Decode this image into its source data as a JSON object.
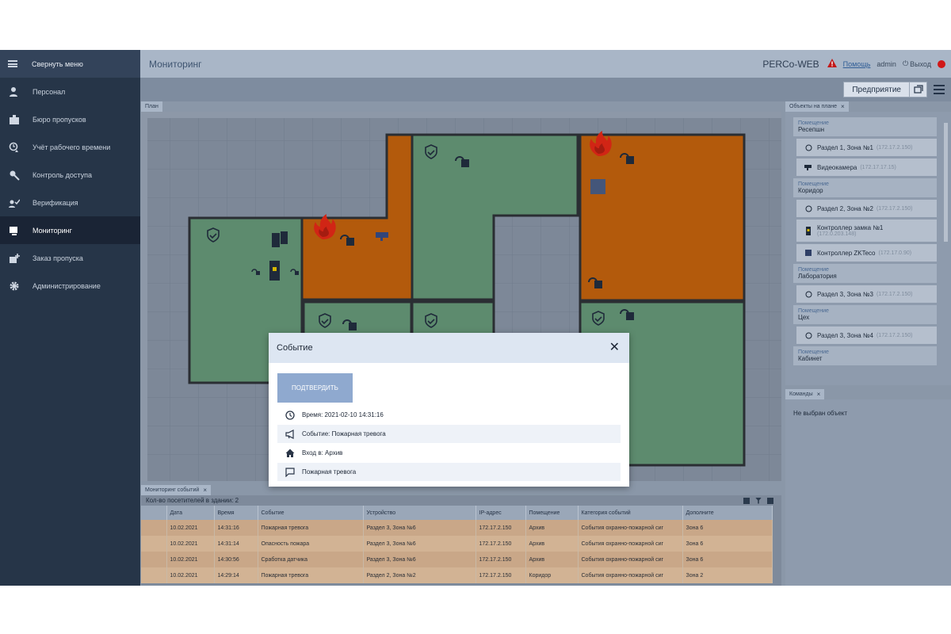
{
  "sidebar": {
    "collapse_label": "Свернуть меню",
    "items": [
      {
        "label": "Персонал",
        "icon": "person-icon"
      },
      {
        "label": "Бюро пропусков",
        "icon": "badge-icon"
      },
      {
        "label": "Учёт рабочего времени",
        "icon": "clock-person-icon"
      },
      {
        "label": "Контроль доступа",
        "icon": "key-icon"
      },
      {
        "label": "Верификация",
        "icon": "verify-icon"
      },
      {
        "label": "Мониторинг",
        "icon": "monitor-icon",
        "active": true
      },
      {
        "label": "Заказ пропуска",
        "icon": "order-pass-icon"
      },
      {
        "label": "Администрирование",
        "icon": "gear-icon"
      }
    ]
  },
  "header": {
    "title": "Мониторинг",
    "brand": "PERCo-WEB",
    "help": "Помощь",
    "user": "admin",
    "logout": "Выход"
  },
  "toolbar": {
    "enterprise_label": "Предприятие"
  },
  "plan": {
    "tab_label": "План"
  },
  "objects": {
    "tab_label": "Объекты на плане",
    "entries": [
      {
        "type": "room",
        "caption": "Помещение",
        "name": "Ресепшн"
      },
      {
        "type": "device",
        "icon": "shield-zone-icon",
        "name": "Раздел 1, Зона №1",
        "ip": "(172.17.2.150)"
      },
      {
        "type": "device",
        "icon": "camera-icon",
        "name": "Видеокамера",
        "ip": "(172.17.17.15)"
      },
      {
        "type": "room",
        "caption": "Помещение",
        "name": "Коридор"
      },
      {
        "type": "device",
        "icon": "shield-zone-icon",
        "name": "Раздел 2, Зона №2",
        "ip": "(172.17.2.150)"
      },
      {
        "type": "device2",
        "icon": "lock-controller-icon",
        "name": "Контроллер замка №1",
        "ip": "(172.0.203.148)"
      },
      {
        "type": "device",
        "icon": "zkteco-icon",
        "name": "Контроллер ZKTeco",
        "ip": "(172.17.0.90)"
      },
      {
        "type": "room",
        "caption": "Помещение",
        "name": "Лаборатория"
      },
      {
        "type": "device",
        "icon": "shield-zone-icon",
        "name": "Раздел 3, Зона №3",
        "ip": "(172.17.2.150)"
      },
      {
        "type": "room",
        "caption": "Помещение",
        "name": "Цех"
      },
      {
        "type": "device",
        "icon": "shield-zone-icon",
        "name": "Раздел 3, Зона №4",
        "ip": "(172.17.2.150)"
      },
      {
        "type": "room",
        "caption": "Помещение",
        "name": "Кабинет"
      }
    ]
  },
  "commands": {
    "tab_label": "Команды",
    "empty_text": "Не выбран объект"
  },
  "events": {
    "tab_label": "Мониторинг событий",
    "visitors_text": "Кол-во посетителей в здании: 2",
    "columns": [
      "Дата",
      "Время",
      "Событие",
      "Устройство",
      "IP-адрес",
      "Помещение",
      "Категория событий",
      "Дополните"
    ],
    "rows": [
      [
        "10.02.2021",
        "14:31:16",
        "Пожарная тревога",
        "Раздел 3, Зона №6",
        "172.17.2.150",
        "Архив",
        "События охранно-пожарной сиг",
        "Зона 6"
      ],
      [
        "10.02.2021",
        "14:31:14",
        "Опасность пожара",
        "Раздел 3, Зона №6",
        "172.17.2.150",
        "Архив",
        "События охранно-пожарной сиг",
        "Зона 6"
      ],
      [
        "10.02.2021",
        "14:30:56",
        "Сработка датчика",
        "Раздел 3, Зона №6",
        "172.17.2.150",
        "Архив",
        "События охранно-пожарной сиг",
        "Зона 6"
      ],
      [
        "10.02.2021",
        "14:29:14",
        "Пожарная тревога",
        "Раздел 2, Зона №2",
        "172.17.2.150",
        "Коридор",
        "События охранно-пожарной сиг",
        "Зона 2"
      ]
    ]
  },
  "modal": {
    "title": "Событие",
    "confirm_label": "ПОДТВЕРДИТЬ",
    "rows": [
      {
        "icon": "clock-icon",
        "text": "Время: 2021-02-10 14:31:16"
      },
      {
        "icon": "megaphone-icon",
        "text": "Событие: Пожарная тревога"
      },
      {
        "icon": "home-icon",
        "text": "Вход в: Архив"
      },
      {
        "icon": "comment-icon",
        "text": "Пожарная тревога"
      }
    ]
  },
  "colors": {
    "alarm_room": "#b35a0c",
    "normal_room": "#5d8b6e",
    "sidebar": "#263548",
    "alert_red": "#d01818"
  }
}
